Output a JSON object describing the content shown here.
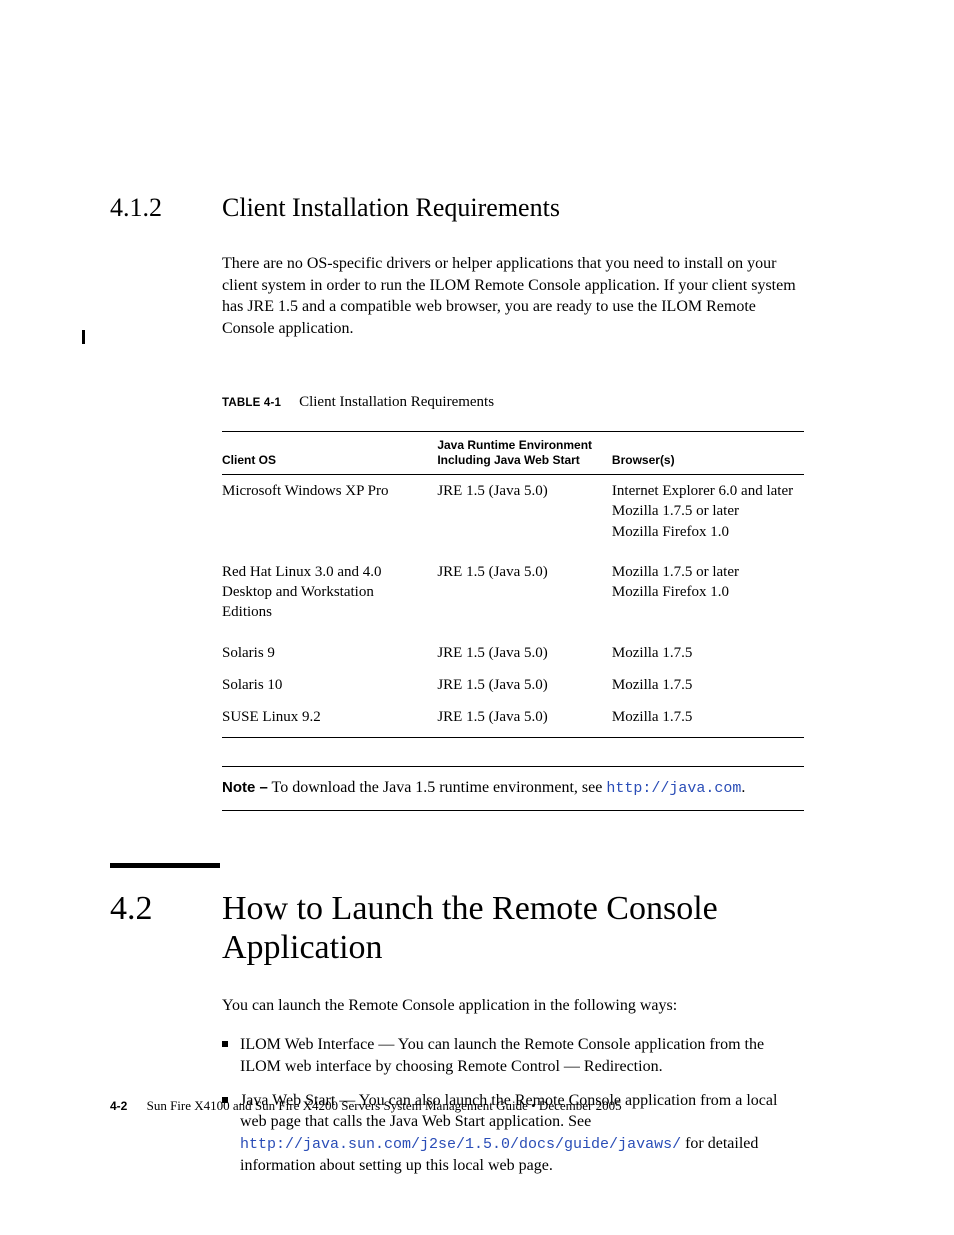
{
  "section412": {
    "number": "4.1.2",
    "title": "Client Installation Requirements",
    "paragraph": "There are no OS-specific drivers or helper applications that you need to install on your client system in order to run the ILOM Remote Console application. If your client system has JRE 1.5 and a compatible web browser, you are ready to use the ILOM Remote Console application."
  },
  "table": {
    "caption_label": "TABLE 4-1",
    "caption_text": "Client Installation Requirements",
    "headers": {
      "col1": "Client OS",
      "col2a": "Java Runtime Environment",
      "col2b": "Including Java Web Start",
      "col3": "Browser(s)"
    },
    "rows": [
      {
        "os": "Microsoft Windows XP Pro",
        "jre": "JRE 1.5 (Java 5.0)",
        "browsers": [
          "Internet Explorer 6.0 and later",
          "Mozilla 1.7.5 or later",
          "Mozilla Firefox 1.0"
        ]
      },
      {
        "os": "Red Hat Linux 3.0 and 4.0 Desktop and Workstation Editions",
        "jre": "JRE 1.5 (Java 5.0)",
        "browsers": [
          "Mozilla 1.7.5 or later",
          "Mozilla Firefox 1.0"
        ]
      },
      {
        "os": "Solaris 9",
        "jre": "JRE 1.5 (Java 5.0)",
        "browsers": [
          "Mozilla 1.7.5"
        ]
      },
      {
        "os": "Solaris 10",
        "jre": "JRE 1.5 (Java 5.0)",
        "browsers": [
          "Mozilla 1.7.5"
        ]
      },
      {
        "os": "SUSE Linux 9.2",
        "jre": "JRE 1.5 (Java 5.0)",
        "browsers": [
          "Mozilla 1.7.5"
        ]
      }
    ]
  },
  "note": {
    "label": "Note –",
    "text_before": " To download the Java 1.5 runtime environment, see ",
    "link": "http://java.com",
    "text_after": "."
  },
  "section42": {
    "number": "4.2",
    "title": "How to Launch the Remote Console Application",
    "intro": "You can launch the Remote Console application in the following ways:",
    "bullets": [
      {
        "text": "ILOM Web Interface — You can launch the Remote Console application from the ILOM web interface by choosing Remote Control — Redirection."
      },
      {
        "text_before": "Java Web Start — You can also launch the Remote Console application from a local web page that calls the Java Web Start application. See ",
        "link": "http://java.sun.com/j2se/1.5.0/docs/guide/javaws/",
        "text_after": " for detailed information about setting up this local web page."
      }
    ]
  },
  "footer": {
    "page": "4-2",
    "text": "Sun Fire X4100 and Sun Fire X4200 Servers System Management Guide • December 2005"
  }
}
